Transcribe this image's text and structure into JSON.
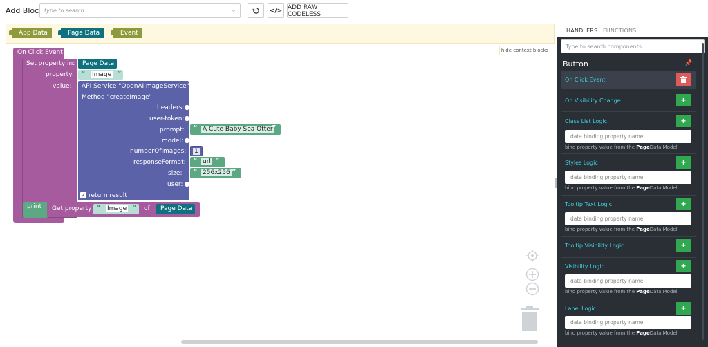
{
  "toolbar": {
    "add_block_label": "Add Block:",
    "search_placeholder": "type to search...",
    "raw_codeless_label": "ADD RAW CODELESS"
  },
  "context": {
    "blocks": [
      "App Data",
      "Page Data",
      "Event"
    ],
    "hide_label": "hide context blocks"
  },
  "blocks": {
    "event_title": "On Click Event",
    "set_property_in": "Set property in:",
    "page_data": "Page Data",
    "property_label": "property:",
    "property_value": "Image",
    "value_label": "value:",
    "api_service": "API Service \"OpenAIImageService\"",
    "method": "Method \"createImage\"",
    "headers": "headers:",
    "user_token": "user-token:",
    "prompt": "prompt:",
    "prompt_value": "A Cute Baby Sea Otter",
    "model": "model:",
    "number_of_images": "numberOfImages:",
    "number_of_images_value": "1",
    "response_format": "responseFormat:",
    "response_format_value": "url",
    "size": "size:",
    "size_value": "256x256",
    "user": "user:",
    "return_result": "return result",
    "print": "print",
    "get_property": "Get property",
    "get_property_value": "Image",
    "of": "of",
    "get_page_data": "Page Data"
  },
  "sidebar": {
    "tabs": [
      "HANDLERS",
      "FUNCTIONS"
    ],
    "search_placeholder": "Type to search components...",
    "component_title": "Button",
    "input_placeholder": "data binding property name",
    "hint_prefix": "bind property value from the ",
    "hint_bold": "Page",
    "hint_suffix": "Data Model",
    "handlers": [
      "On Click Event",
      "On Visibility Change",
      "Class List Logic",
      "Styles Logic",
      "Tooltip Text Logic",
      "Tooltip Visibility Logic",
      "Visibility Logic",
      "Label Logic"
    ]
  },
  "colors": {
    "event": "#a55b9e",
    "teal": "#0f7180",
    "api": "#5b62a8",
    "green": "#5ca883",
    "context_bg": "#fff8e1",
    "sidebar_bg": "#2a2e35"
  }
}
